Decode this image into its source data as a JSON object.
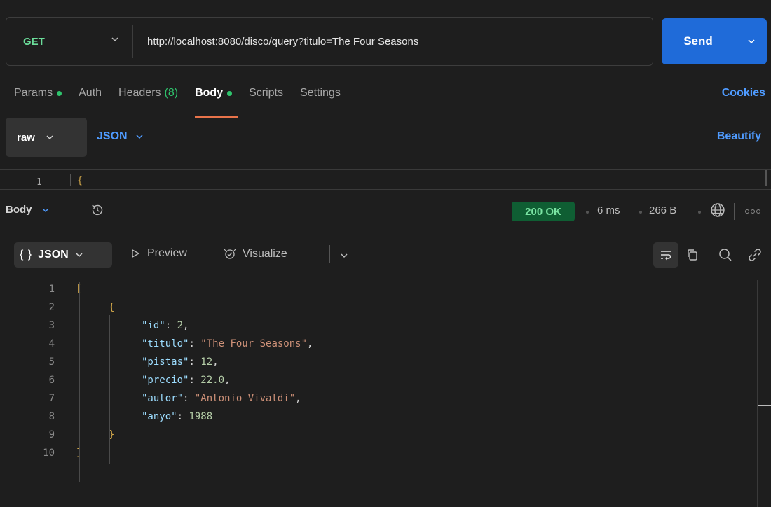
{
  "request": {
    "method": "GET",
    "url": "http://localhost:8080/disco/query?titulo=The Four Seasons",
    "send_label": "Send"
  },
  "request_tabs": [
    {
      "label": "Params",
      "dot": true
    },
    {
      "label": "Auth"
    },
    {
      "label": "Headers",
      "count": "(8)"
    },
    {
      "label": "Body",
      "dot": true,
      "active": true
    },
    {
      "label": "Scripts"
    },
    {
      "label": "Settings"
    }
  ],
  "cookies_label": "Cookies",
  "body_type": {
    "mode": "raw",
    "format": "JSON",
    "beautify_label": "Beautify"
  },
  "request_editor": {
    "line_number": "1",
    "line_text": "{"
  },
  "response": {
    "body_label": "Body",
    "status": "200 OK",
    "time": "6 ms",
    "size": "266 B",
    "view_label": "{ } JSON",
    "view_brace": "{ }",
    "view_format": "JSON",
    "preview_label": "Preview",
    "visualize_label": "Visualize"
  },
  "response_code": [
    {
      "n": "1",
      "indent": 0,
      "tokens": [
        {
          "t": "[",
          "c": "bracket"
        }
      ]
    },
    {
      "n": "2",
      "indent": 1,
      "tokens": [
        {
          "t": "{",
          "c": "bracket"
        }
      ]
    },
    {
      "n": "3",
      "indent": 2,
      "tokens": [
        {
          "t": "\"id\"",
          "c": "key"
        },
        {
          "t": ": ",
          "c": "punc"
        },
        {
          "t": "2",
          "c": "num"
        },
        {
          "t": ",",
          "c": "punc"
        }
      ]
    },
    {
      "n": "4",
      "indent": 2,
      "tokens": [
        {
          "t": "\"titulo\"",
          "c": "key"
        },
        {
          "t": ": ",
          "c": "punc"
        },
        {
          "t": "\"The Four Seasons\"",
          "c": "str"
        },
        {
          "t": ",",
          "c": "punc"
        }
      ]
    },
    {
      "n": "5",
      "indent": 2,
      "tokens": [
        {
          "t": "\"pistas\"",
          "c": "key"
        },
        {
          "t": ": ",
          "c": "punc"
        },
        {
          "t": "12",
          "c": "num"
        },
        {
          "t": ",",
          "c": "punc"
        }
      ]
    },
    {
      "n": "6",
      "indent": 2,
      "tokens": [
        {
          "t": "\"precio\"",
          "c": "key"
        },
        {
          "t": ": ",
          "c": "punc"
        },
        {
          "t": "22.0",
          "c": "num"
        },
        {
          "t": ",",
          "c": "punc"
        }
      ]
    },
    {
      "n": "7",
      "indent": 2,
      "tokens": [
        {
          "t": "\"autor\"",
          "c": "key"
        },
        {
          "t": ": ",
          "c": "punc"
        },
        {
          "t": "\"Antonio Vivaldi\"",
          "c": "str"
        },
        {
          "t": ",",
          "c": "punc"
        }
      ]
    },
    {
      "n": "8",
      "indent": 2,
      "tokens": [
        {
          "t": "\"anyo\"",
          "c": "key"
        },
        {
          "t": ": ",
          "c": "punc"
        },
        {
          "t": "1988",
          "c": "num"
        }
      ]
    },
    {
      "n": "9",
      "indent": 1,
      "tokens": [
        {
          "t": "}",
          "c": "bracket"
        }
      ]
    },
    {
      "n": "10",
      "indent": 0,
      "tokens": [
        {
          "t": "]",
          "c": "bracket"
        }
      ]
    }
  ],
  "colors": {
    "background": "#1e1e1e",
    "accent_blue": "#1f6bd9",
    "method_green": "#6bdd9a",
    "status_green": "#0f5e33",
    "active_tab_underline": "#e8734a"
  },
  "icons": [
    "chevron-down-icon",
    "history-icon",
    "globe-icon",
    "more-icon",
    "play-icon",
    "visualize-icon",
    "wrap-icon",
    "copy-icon",
    "search-icon",
    "link-icon"
  ]
}
